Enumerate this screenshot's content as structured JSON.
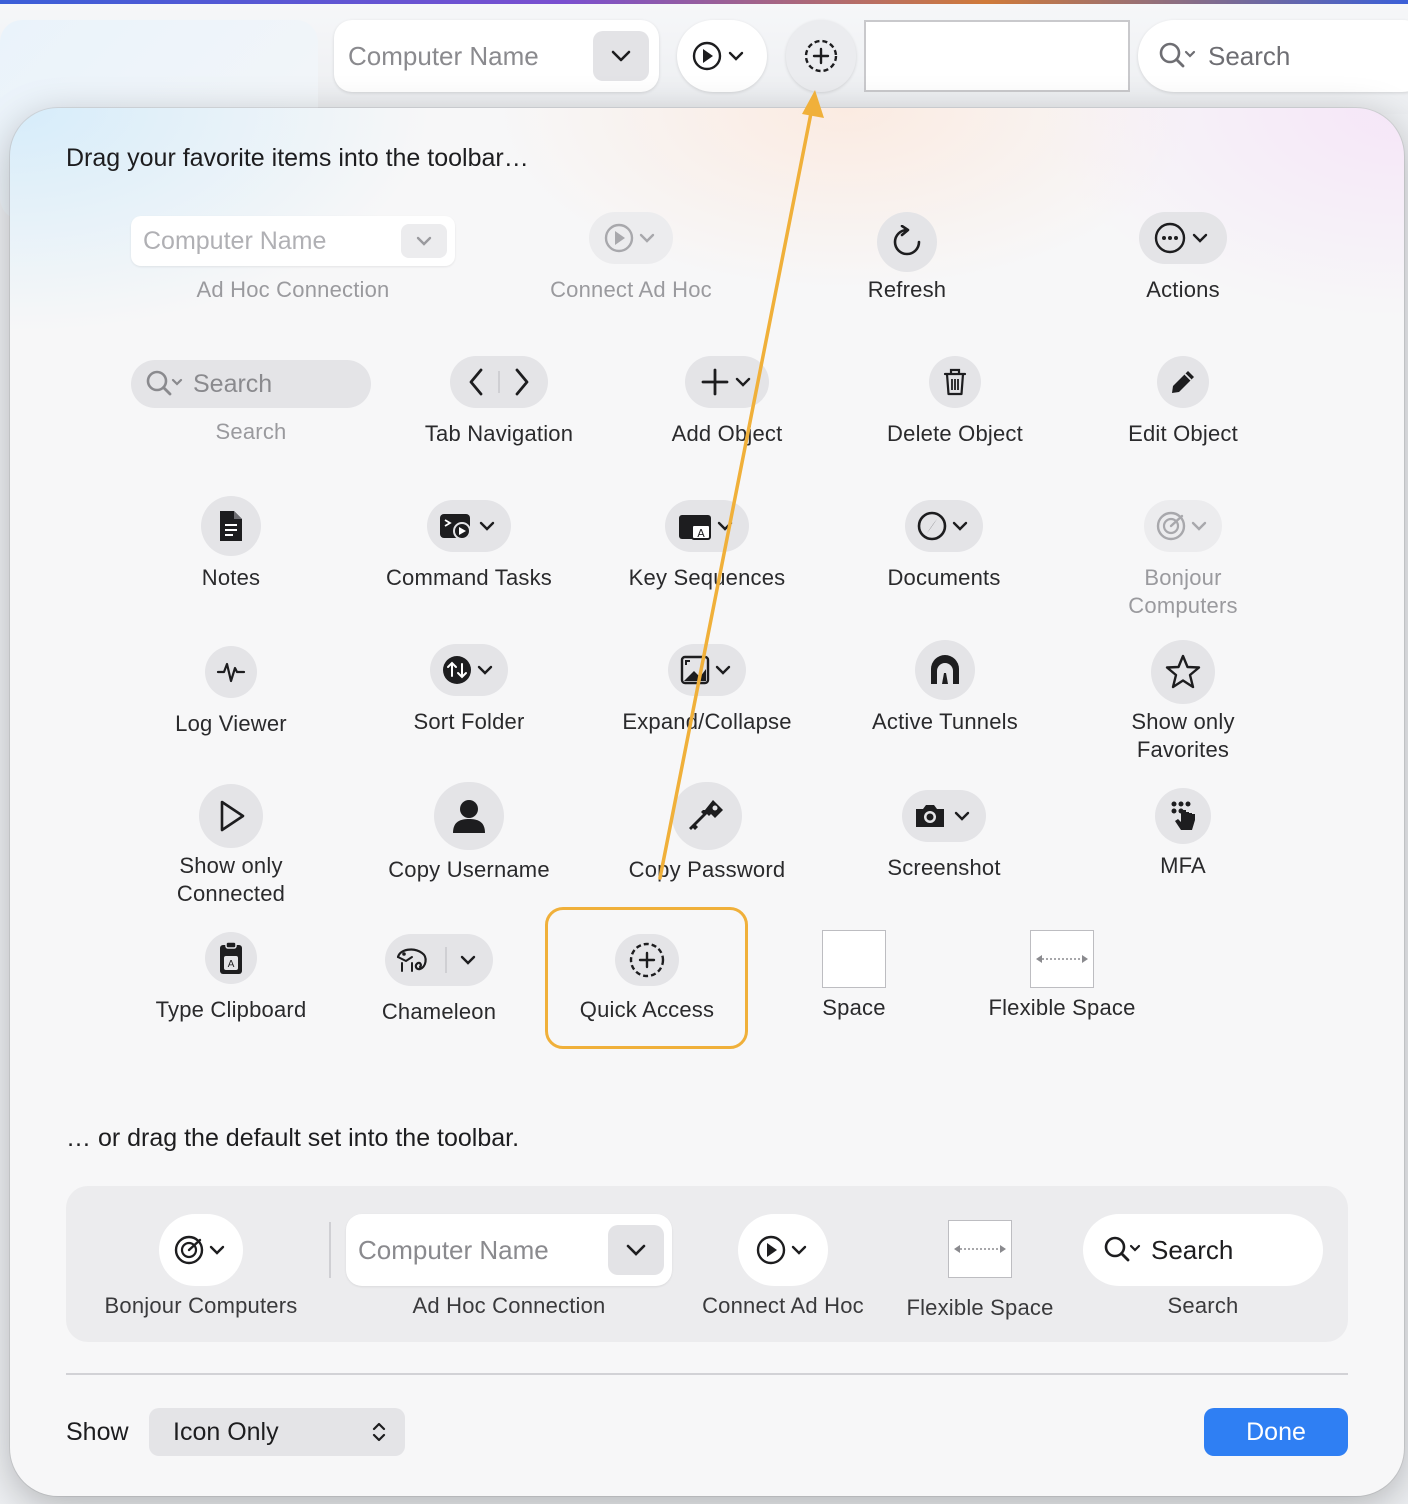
{
  "toolbar": {
    "computer_name_placeholder": "Computer Name",
    "search_placeholder": "Search"
  },
  "sheet": {
    "heading": "Drag your favorite items into the toolbar…",
    "default_heading": "… or drag the default set into the toolbar.",
    "items": {
      "adhoc_placeholder": "Computer Name",
      "adhoc": "Ad Hoc Connection",
      "connect": "Connect Ad Hoc",
      "refresh": "Refresh",
      "actions": "Actions",
      "search_placeholder": "Search",
      "search": "Search",
      "tabnav": "Tab Navigation",
      "add": "Add Object",
      "delete": "Delete Object",
      "edit": "Edit Object",
      "notes": "Notes",
      "commands": "Command Tasks",
      "keyseq": "Key Sequences",
      "documents": "Documents",
      "bonjour": "Bonjour\nComputers",
      "logviewer": "Log Viewer",
      "sortfolder": "Sort Folder",
      "expand": "Expand/Collapse",
      "tunnels": "Active Tunnels",
      "favorites": "Show only\nFavorites",
      "connected": "Show only\nConnected",
      "username": "Copy Username",
      "password": "Copy Password",
      "screenshot": "Screenshot",
      "mfa": "MFA",
      "clipboard": "Type Clipboard",
      "chameleon": "Chameleon",
      "quickaccess": "Quick Access",
      "space": "Space",
      "flexspace": "Flexible Space"
    },
    "default_set": {
      "bonjour": "Bonjour Computers",
      "adhoc_placeholder": "Computer Name",
      "adhoc": "Ad Hoc Connection",
      "connect": "Connect Ad Hoc",
      "flexspace": "Flexible Space",
      "search_placeholder": "Search",
      "search": "Search"
    },
    "footer": {
      "show_label": "Show",
      "show_value": "Icon Only",
      "done": "Done"
    }
  },
  "colors": {
    "accent": "#2f7ff3",
    "highlight": "#f0b03a"
  }
}
